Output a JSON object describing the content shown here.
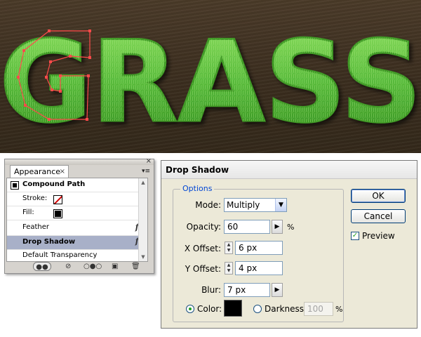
{
  "artwork": {
    "text": "GRASS",
    "colors": {
      "background": "#3c2f20",
      "grass_light": "#7ed25a",
      "grass_dark": "#2f8a1c",
      "anchor": "#ff4a4a"
    }
  },
  "appearance": {
    "tab_label": "Appearance",
    "close_glyph": "×",
    "menu_glyph": "▾≡",
    "title": "Compound Path",
    "stroke_label": "Stroke:",
    "fill_label": "Fill:",
    "items": [
      {
        "label": "Feather",
        "fx": "fx"
      },
      {
        "label": "Drop Shadow",
        "fx": "fx"
      },
      {
        "label": "Default Transparency",
        "fx": ""
      }
    ]
  },
  "dialog": {
    "title": "Drop Shadow",
    "options_legend": "Options",
    "mode": {
      "label": "Mode:",
      "value": "Multiply"
    },
    "opacity": {
      "label": "Opacity:",
      "value": "60",
      "unit": "%"
    },
    "x_offset": {
      "label": "X Offset:",
      "value": "6 px"
    },
    "y_offset": {
      "label": "Y Offset:",
      "value": "4 px"
    },
    "blur": {
      "label": "Blur:",
      "value": "7 px"
    },
    "color_label": "Color:",
    "color_value": "#000000",
    "darkness": {
      "label": "Darkness:",
      "value": "100",
      "unit": "%"
    },
    "buttons": {
      "ok": "OK",
      "cancel": "Cancel"
    },
    "preview": {
      "label": "Preview",
      "checked": true
    }
  }
}
